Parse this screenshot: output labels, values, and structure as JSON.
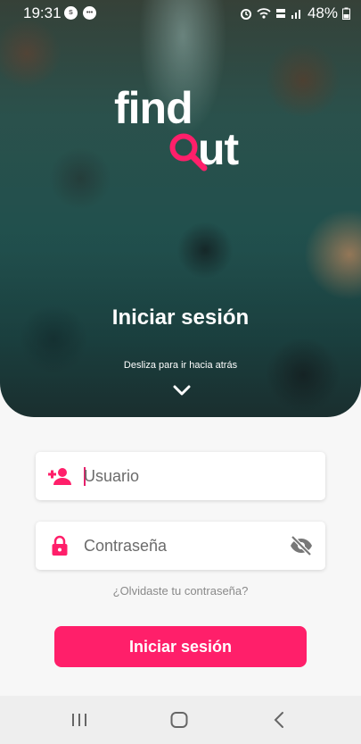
{
  "status_bar": {
    "time": "19:31",
    "left_icons": [
      "shazam-icon",
      "notification-badge-icon"
    ],
    "right_icons": [
      "alarm-icon",
      "wifi-icon",
      "volte-icon",
      "signal-icon",
      "battery-icon"
    ],
    "battery": "48%"
  },
  "logo": {
    "line1": "find",
    "line2": "ut"
  },
  "hero": {
    "title": "Iniciar sesión",
    "swipe_hint": "Desliza para ir hacia atrás"
  },
  "form": {
    "username": {
      "placeholder": "Usuario",
      "value": ""
    },
    "password": {
      "placeholder": "Contraseña",
      "value": ""
    },
    "forgot_link": "¿Olvidaste tu contraseña?",
    "submit_label": "Iniciar sesión"
  },
  "nav": [
    "recents-icon",
    "home-icon",
    "back-icon"
  ],
  "colors": {
    "accent": "#ff1f6a",
    "background": "#f7f7f7"
  }
}
